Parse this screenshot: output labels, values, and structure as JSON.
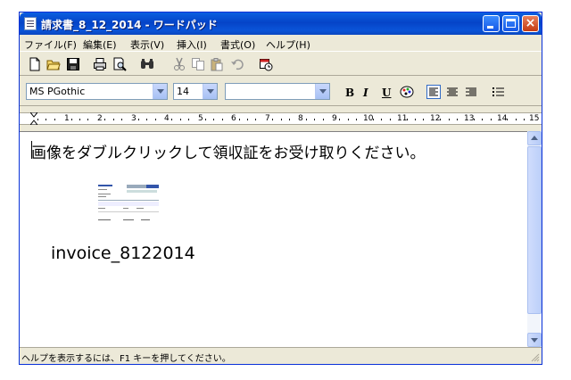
{
  "window": {
    "title": "請求書_8_12_2014 - ワードパッド",
    "minimize_label": "Minimize",
    "maximize_label": "Maximize",
    "close_label": "×"
  },
  "menu": {
    "items": [
      "ファイル(F)",
      "編集(E)",
      "表示(V)",
      "挿入(I)",
      "書式(O)",
      "ヘルプ(H)"
    ]
  },
  "format": {
    "font_name": "MS PGothic",
    "font_size": "14",
    "script": "",
    "bold_label": "B",
    "italic_label": "I",
    "underline_label": "U"
  },
  "ruler": {
    "marks": [
      "1",
      "2",
      "3",
      "4",
      "5",
      "6",
      "7",
      "8",
      "9",
      "10",
      "11",
      "12",
      "13",
      "14",
      "15"
    ]
  },
  "document": {
    "instruction": "画像をダブルクリックして領収証をお受け取りください。",
    "filename": "invoice_8122014"
  },
  "status": {
    "text": "ヘルプを表示するには、F1 キーを押してください。"
  },
  "colors": {
    "titlebar": "#0a54d8",
    "chrome": "#ece9d8",
    "close": "#c43b13"
  },
  "icons": [
    "new-document-icon",
    "open-folder-icon",
    "save-disk-icon",
    "print-icon",
    "print-preview-icon",
    "find-icon",
    "cut-icon",
    "copy-icon",
    "paste-icon",
    "undo-icon",
    "insert-datetime-icon",
    "color-palette-icon",
    "align-left-icon",
    "align-center-icon",
    "align-right-icon",
    "bullets-icon"
  ]
}
